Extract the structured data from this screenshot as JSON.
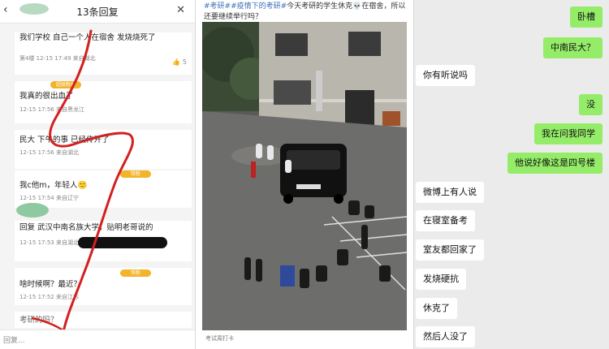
{
  "left": {
    "back_icon": "chevron-left-icon",
    "title": "13条回复",
    "close_icon": "close-icon",
    "comments": [
      {
        "text": "我们学校 自己一个人在宿舍 发烧烧死了",
        "meta": "第4楼 12-15 17:49 来自湖北",
        "likes": "5"
      },
      {
        "text": "我真的很出血了",
        "meta": "12-15 17:56 来自黑龙江",
        "tag": "超级粉丝"
      },
      {
        "text": "民大 下午的事 已经传开了",
        "meta": "12-15 17:56 来自湖北"
      },
      {
        "text": "我c他m，年轻人🙁",
        "meta": "12-15 17:54 来自辽宁",
        "tag": "铁粉"
      },
      {
        "text": "回复 武汉中南名族大学，贴明老哥说的",
        "meta": "12-15 17:53 来自湖北"
      },
      {
        "text": "啥时候啊？最近？",
        "meta": "12-15 17:52 来自江苏",
        "tag": "铁粉"
      },
      {
        "text": "考研的吗？",
        "meta": ""
      }
    ],
    "reply_placeholder": "回复..."
  },
  "middle": {
    "caption_tags": "#考研##疫情下的考研#",
    "caption_text": "今天考研的学生休克💀在宿舍，所以还要继续举行吗？",
    "footer": "考试周打卡"
  },
  "right": {
    "messages": [
      {
        "side": "me",
        "text": "卧槽"
      },
      {
        "side": "me",
        "text": "中南民大？"
      },
      {
        "side": "other",
        "text": "你有听说吗"
      },
      {
        "side": "me",
        "text": "没"
      },
      {
        "side": "me",
        "text": "我在问我同学"
      },
      {
        "side": "me",
        "text": "他说好像这是四号楼"
      },
      {
        "side": "other",
        "text": "微博上有人说"
      },
      {
        "side": "other",
        "text": "在寝室备考"
      },
      {
        "side": "other",
        "text": "室友都回家了"
      },
      {
        "side": "other",
        "text": "发烧硬抗"
      },
      {
        "side": "other",
        "text": "休克了"
      },
      {
        "side": "other",
        "text": "然后人没了"
      }
    ]
  },
  "colors": {
    "me_bubble": "#95ec69",
    "other_bubble": "#ffffff",
    "annotation_red": "#d32020",
    "tag": "#f3b32a"
  }
}
